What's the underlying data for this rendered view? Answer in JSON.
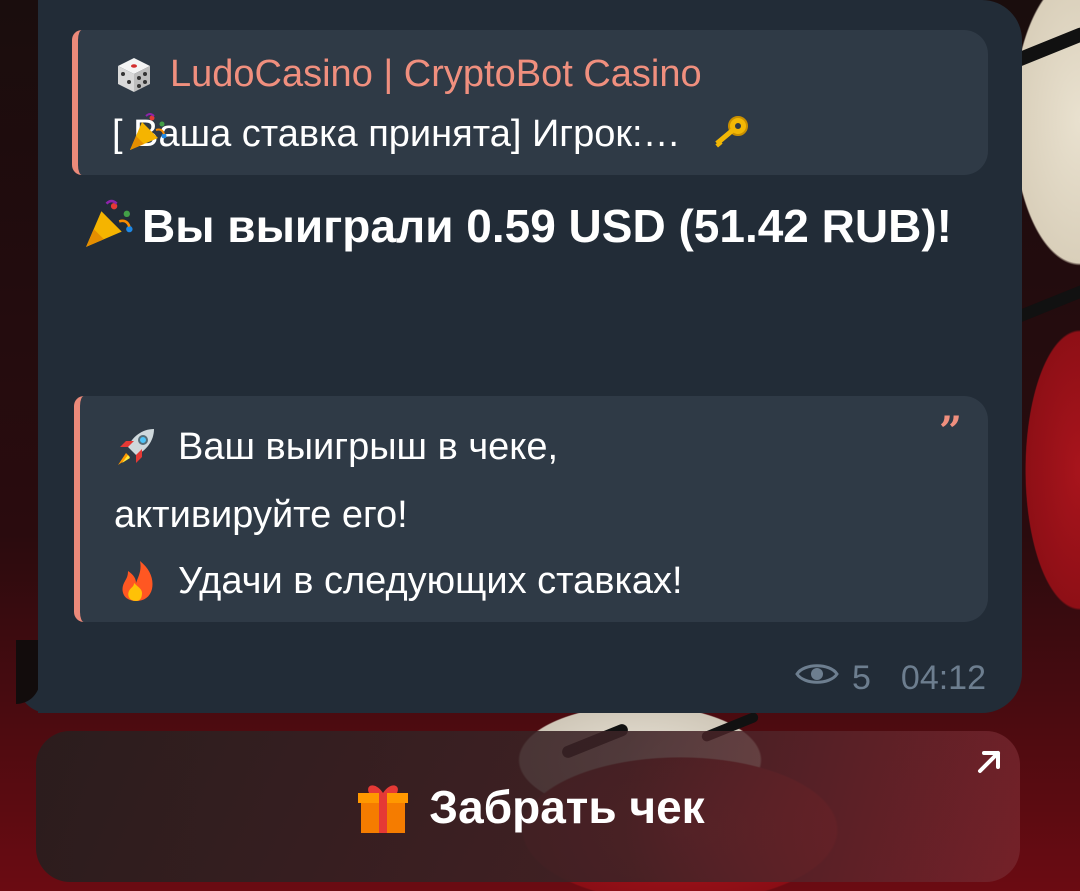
{
  "reply": {
    "title": "LudoCasino | CryptoBot Casino",
    "text": "[ Ваша ставка принята]  Игрок:…"
  },
  "message": {
    "text": "Вы выиграли 0.59 USD (51.42 RUB)!"
  },
  "quote": {
    "line1": "Ваш выигрыш в чеке,",
    "line2": "активируйте его!",
    "line3": "Удачи в следующих ставках!"
  },
  "meta": {
    "views": "5",
    "time": "04:12"
  },
  "button": {
    "label": "Забрать чек"
  },
  "colors": {
    "bubble": "#222c37",
    "accent": "#f08f7e",
    "meta": "#6d7e8f"
  },
  "icons": [
    "dice-icon",
    "party-popper-icon",
    "key-icon",
    "rocket-icon",
    "fire-icon",
    "eye-icon",
    "gift-icon",
    "arrow-up-right-icon",
    "quote-mark-icon"
  ]
}
